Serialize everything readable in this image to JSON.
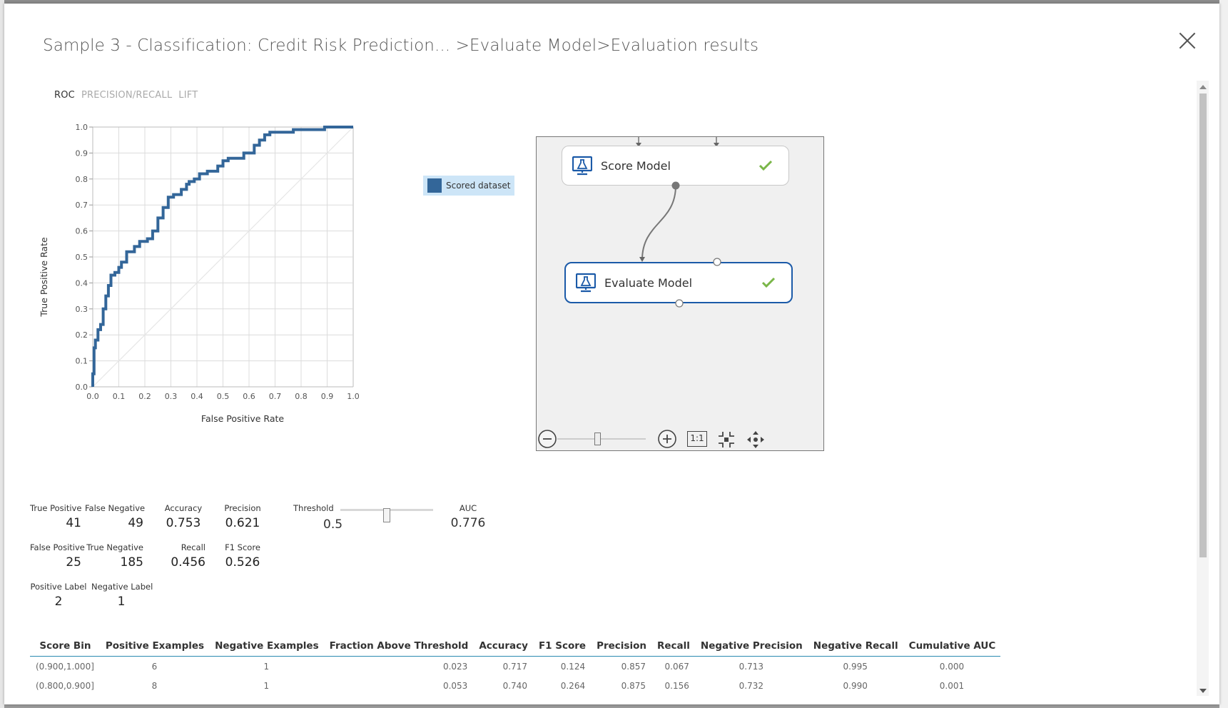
{
  "dialog": {
    "title": "Sample 3 - Classification: Credit Risk Prediction... >Evaluate Model>Evaluation results"
  },
  "tabs": [
    {
      "label": "ROC",
      "active": true
    },
    {
      "label": "PRECISION/RECALL",
      "active": false
    },
    {
      "label": "LIFT",
      "active": false
    }
  ],
  "legend": {
    "label": "Scored dataset",
    "color": "#336699"
  },
  "chart_data": {
    "type": "line",
    "title": "",
    "xlabel": "False Positive Rate",
    "ylabel": "True Positive Rate",
    "xlim": [
      0,
      1
    ],
    "ylim": [
      0,
      1
    ],
    "xticks": [
      "0.0",
      "0.1",
      "0.2",
      "0.3",
      "0.4",
      "0.5",
      "0.6",
      "0.7",
      "0.8",
      "0.9",
      "1.0"
    ],
    "yticks": [
      "0.0",
      "0.1",
      "0.2",
      "0.3",
      "0.4",
      "0.5",
      "0.6",
      "0.7",
      "0.8",
      "0.9",
      "1.0"
    ],
    "grid": true,
    "series": [
      {
        "name": "Scored dataset",
        "color": "#336699",
        "x": [
          0.0,
          0.0,
          0.005,
          0.005,
          0.01,
          0.01,
          0.02,
          0.02,
          0.03,
          0.03,
          0.04,
          0.04,
          0.05,
          0.05,
          0.06,
          0.06,
          0.07,
          0.07,
          0.085,
          0.085,
          0.1,
          0.1,
          0.11,
          0.11,
          0.13,
          0.13,
          0.16,
          0.16,
          0.18,
          0.18,
          0.21,
          0.21,
          0.23,
          0.23,
          0.25,
          0.25,
          0.27,
          0.27,
          0.29,
          0.29,
          0.31,
          0.31,
          0.34,
          0.34,
          0.36,
          0.36,
          0.37,
          0.37,
          0.39,
          0.39,
          0.41,
          0.41,
          0.44,
          0.44,
          0.48,
          0.48,
          0.5,
          0.5,
          0.52,
          0.52,
          0.58,
          0.58,
          0.62,
          0.62,
          0.64,
          0.64,
          0.66,
          0.66,
          0.68,
          0.68,
          0.77,
          0.77,
          0.8,
          0.8,
          0.89,
          0.89,
          0.91,
          0.91,
          1.0
        ],
        "y": [
          0.0,
          0.05,
          0.05,
          0.15,
          0.15,
          0.18,
          0.18,
          0.22,
          0.22,
          0.24,
          0.24,
          0.3,
          0.3,
          0.35,
          0.35,
          0.39,
          0.39,
          0.43,
          0.43,
          0.44,
          0.44,
          0.46,
          0.46,
          0.48,
          0.48,
          0.52,
          0.52,
          0.54,
          0.54,
          0.56,
          0.56,
          0.57,
          0.57,
          0.6,
          0.6,
          0.65,
          0.65,
          0.69,
          0.69,
          0.73,
          0.73,
          0.74,
          0.74,
          0.76,
          0.76,
          0.78,
          0.78,
          0.79,
          0.79,
          0.8,
          0.8,
          0.82,
          0.82,
          0.83,
          0.83,
          0.85,
          0.85,
          0.87,
          0.87,
          0.88,
          0.88,
          0.9,
          0.9,
          0.93,
          0.93,
          0.95,
          0.95,
          0.97,
          0.97,
          0.98,
          0.98,
          0.99,
          0.99,
          0.99,
          0.99,
          1.0,
          1.0,
          1.0,
          1.0
        ]
      },
      {
        "name": "",
        "color": "#e6e6e6",
        "x": [
          0,
          1
        ],
        "y": [
          0,
          1
        ]
      }
    ]
  },
  "canvas": {
    "modules": [
      {
        "label": "Score Model",
        "status": "check"
      },
      {
        "label": "Evaluate Model",
        "status": "check",
        "selected": true
      }
    ],
    "controls": {
      "zoom_out": "minus-circle",
      "zoom_in": "plus-circle",
      "actual_size": "1:1",
      "fit": "fit-to-screen",
      "pan": "pan-arrows"
    },
    "zoom_level": 0.45
  },
  "metrics": {
    "true_positive": {
      "label": "True Positive",
      "value": "41"
    },
    "false_negative": {
      "label": "False Negative",
      "value": "49"
    },
    "accuracy": {
      "label": "Accuracy",
      "value": "0.753"
    },
    "precision": {
      "label": "Precision",
      "value": "0.621"
    },
    "false_positive": {
      "label": "False Positive",
      "value": "25"
    },
    "true_negative": {
      "label": "True Negative",
      "value": "185"
    },
    "recall": {
      "label": "Recall",
      "value": "0.456"
    },
    "f1": {
      "label": "F1 Score",
      "value": "0.526"
    },
    "positive_label": {
      "label": "Positive Label",
      "value": "2"
    },
    "negative_label": {
      "label": "Negative Label",
      "value": "1"
    },
    "threshold": {
      "label": "Threshold",
      "value": "0.5",
      "slider_fraction": 0.5
    },
    "auc": {
      "label": "AUC",
      "value": "0.776"
    }
  },
  "bins_table": {
    "headers": [
      "Score Bin",
      "Positive Examples",
      "Negative Examples",
      "Fraction Above Threshold",
      "Accuracy",
      "F1 Score",
      "Precision",
      "Recall",
      "Negative Precision",
      "Negative Recall",
      "Cumulative AUC"
    ],
    "rows": [
      [
        "(0.900,1.000]",
        "6",
        "1",
        "0.023",
        "0.717",
        "0.124",
        "0.857",
        "0.067",
        "0.713",
        "0.995",
        "0.000"
      ],
      [
        "(0.800,0.900]",
        "8",
        "1",
        "0.053",
        "0.740",
        "0.264",
        "0.875",
        "0.156",
        "0.732",
        "0.990",
        "0.001"
      ]
    ]
  },
  "colors": {
    "accent": "#1b5aa8",
    "roc_line": "#336699",
    "check": "#7ab648",
    "table_rule": "#2a8ab0"
  }
}
